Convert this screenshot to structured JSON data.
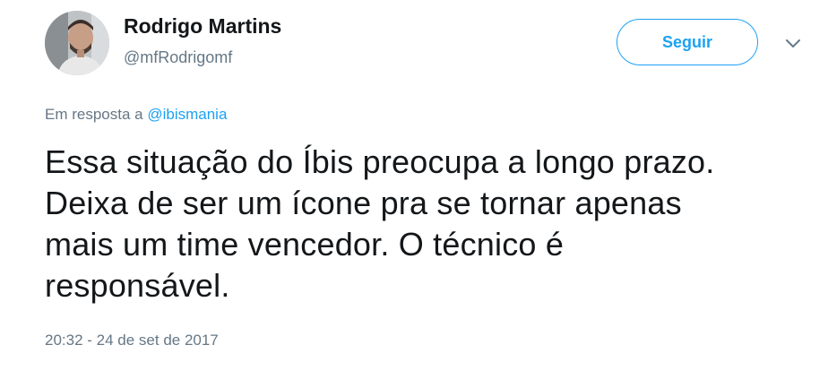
{
  "user": {
    "display_name": "Rodrigo Martins",
    "handle": "@mfRodrigomf"
  },
  "actions": {
    "follow_label": "Seguir",
    "more_icon": "chevron-down-icon"
  },
  "reply": {
    "prefix": "Em resposta a ",
    "mention": "@ibismania"
  },
  "tweet": {
    "line1": "Essa situação do Íbis preocupa a longo prazo.",
    "line2": "Deixa de ser um ícone pra se tornar apenas",
    "line3": "mais um time vencedor. O técnico é",
    "line4": "responsável.",
    "timestamp": "20:32 - 24 de set de 2017"
  },
  "colors": {
    "accent": "#1da1f2",
    "text_primary": "#14171a",
    "text_secondary": "#657786"
  }
}
